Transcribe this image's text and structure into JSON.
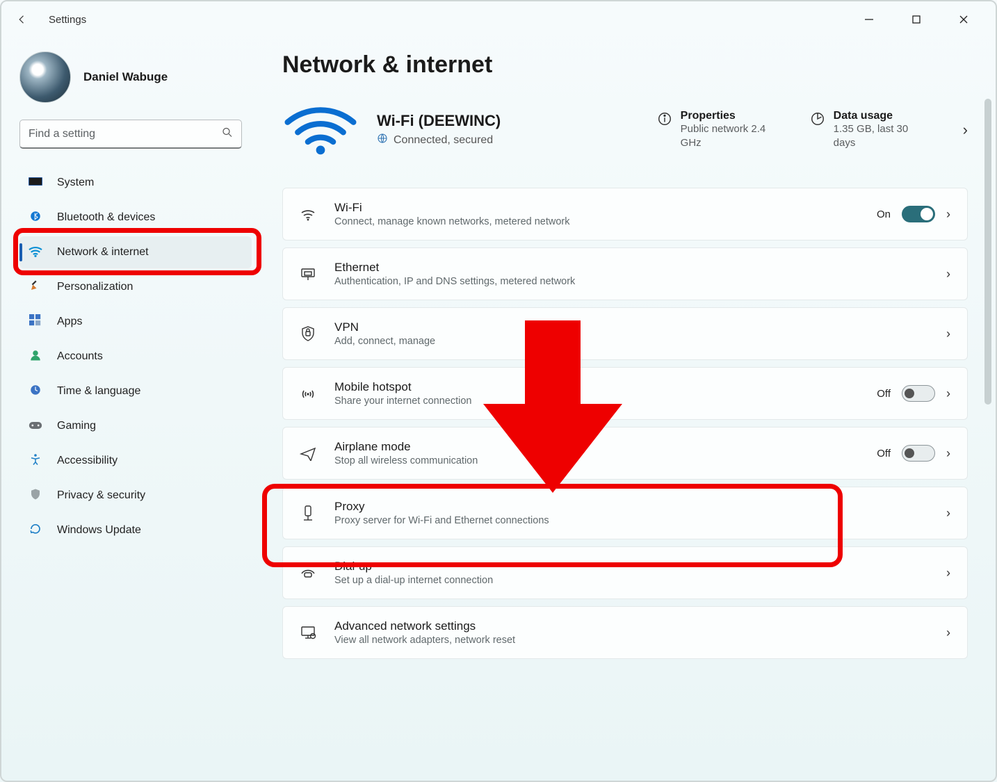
{
  "titlebar": {
    "app_name": "Settings"
  },
  "user": {
    "name": "Daniel Wabuge"
  },
  "search": {
    "placeholder": "Find a setting"
  },
  "sidebar": {
    "items": [
      {
        "label": "System",
        "icon": "system-icon"
      },
      {
        "label": "Bluetooth & devices",
        "icon": "bluetooth-icon"
      },
      {
        "label": "Network & internet",
        "icon": "network-icon",
        "selected": true
      },
      {
        "label": "Personalization",
        "icon": "personalization-icon"
      },
      {
        "label": "Apps",
        "icon": "apps-icon"
      },
      {
        "label": "Accounts",
        "icon": "accounts-icon"
      },
      {
        "label": "Time & language",
        "icon": "time-language-icon"
      },
      {
        "label": "Gaming",
        "icon": "gaming-icon"
      },
      {
        "label": "Accessibility",
        "icon": "accessibility-icon"
      },
      {
        "label": "Privacy & security",
        "icon": "privacy-icon"
      },
      {
        "label": "Windows Update",
        "icon": "update-icon"
      }
    ]
  },
  "page": {
    "title": "Network & internet"
  },
  "hero": {
    "wifi_name": "Wi-Fi (DEEWINC)",
    "status": "Connected, secured",
    "properties": {
      "label": "Properties",
      "value": "Public network 2.4 GHz"
    },
    "usage": {
      "label": "Data usage",
      "value": "1.35 GB, last 30 days"
    }
  },
  "cards": [
    {
      "id": "wifi",
      "title": "Wi-Fi",
      "desc": "Connect, manage known networks, metered network",
      "state_label": "On",
      "toggle": "on"
    },
    {
      "id": "ethernet",
      "title": "Ethernet",
      "desc": "Authentication, IP and DNS settings, metered network"
    },
    {
      "id": "vpn",
      "title": "VPN",
      "desc": "Add, connect, manage"
    },
    {
      "id": "hotspot",
      "title": "Mobile hotspot",
      "desc": "Share your internet connection",
      "state_label": "Off",
      "toggle": "off"
    },
    {
      "id": "airplane",
      "title": "Airplane mode",
      "desc": "Stop all wireless communication",
      "state_label": "Off",
      "toggle": "off"
    },
    {
      "id": "proxy",
      "title": "Proxy",
      "desc": "Proxy server for Wi-Fi and Ethernet connections"
    },
    {
      "id": "dialup",
      "title": "Dial-up",
      "desc": "Set up a dial-up internet connection"
    },
    {
      "id": "advanced",
      "title": "Advanced network settings",
      "desc": "View all network adapters, network reset"
    }
  ]
}
